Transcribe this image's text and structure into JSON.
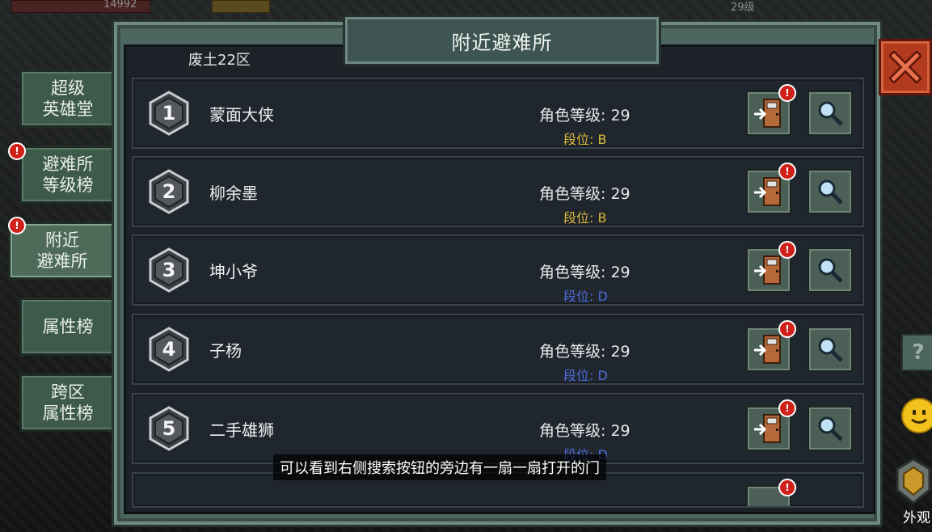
{
  "hud": {
    "hp_value": "14992",
    "level_text": "29级"
  },
  "side_tabs": [
    {
      "line1": "超级",
      "line2": "英雄堂"
    },
    {
      "line1": "避难所",
      "line2": "等级榜"
    },
    {
      "line1": "附近",
      "line2": "避难所"
    },
    {
      "line1": "属性榜",
      "line2": ""
    },
    {
      "line1": "跨区",
      "line2": "属性榜"
    }
  ],
  "badge_text": "!",
  "panel": {
    "title": "附近避难所",
    "region": "废土22区"
  },
  "rows": [
    {
      "rank": "1",
      "name": "蒙面大侠",
      "level_label": "角色等级: 29",
      "tier": "段位: B",
      "tier_color": "#d9b838"
    },
    {
      "rank": "2",
      "name": "柳余墨",
      "level_label": "角色等级: 29",
      "tier": "段位: B",
      "tier_color": "#d9b838"
    },
    {
      "rank": "3",
      "name": "坤小爷",
      "level_label": "角色等级: 29",
      "tier": "段位: D",
      "tier_color": "#4f6ad8"
    },
    {
      "rank": "4",
      "name": "子杨",
      "level_label": "角色等级: 29",
      "tier": "段位: D",
      "tier_color": "#4f6ad8"
    },
    {
      "rank": "5",
      "name": "二手雄狮",
      "level_label": "角色等级: 29",
      "tier": "段位: D",
      "tier_color": "#4f6ad8"
    }
  ],
  "subtitle": "可以看到右侧搜索按钮的旁边有一扇一扇打开的门",
  "help_label": "?",
  "appearance_label": "外观"
}
